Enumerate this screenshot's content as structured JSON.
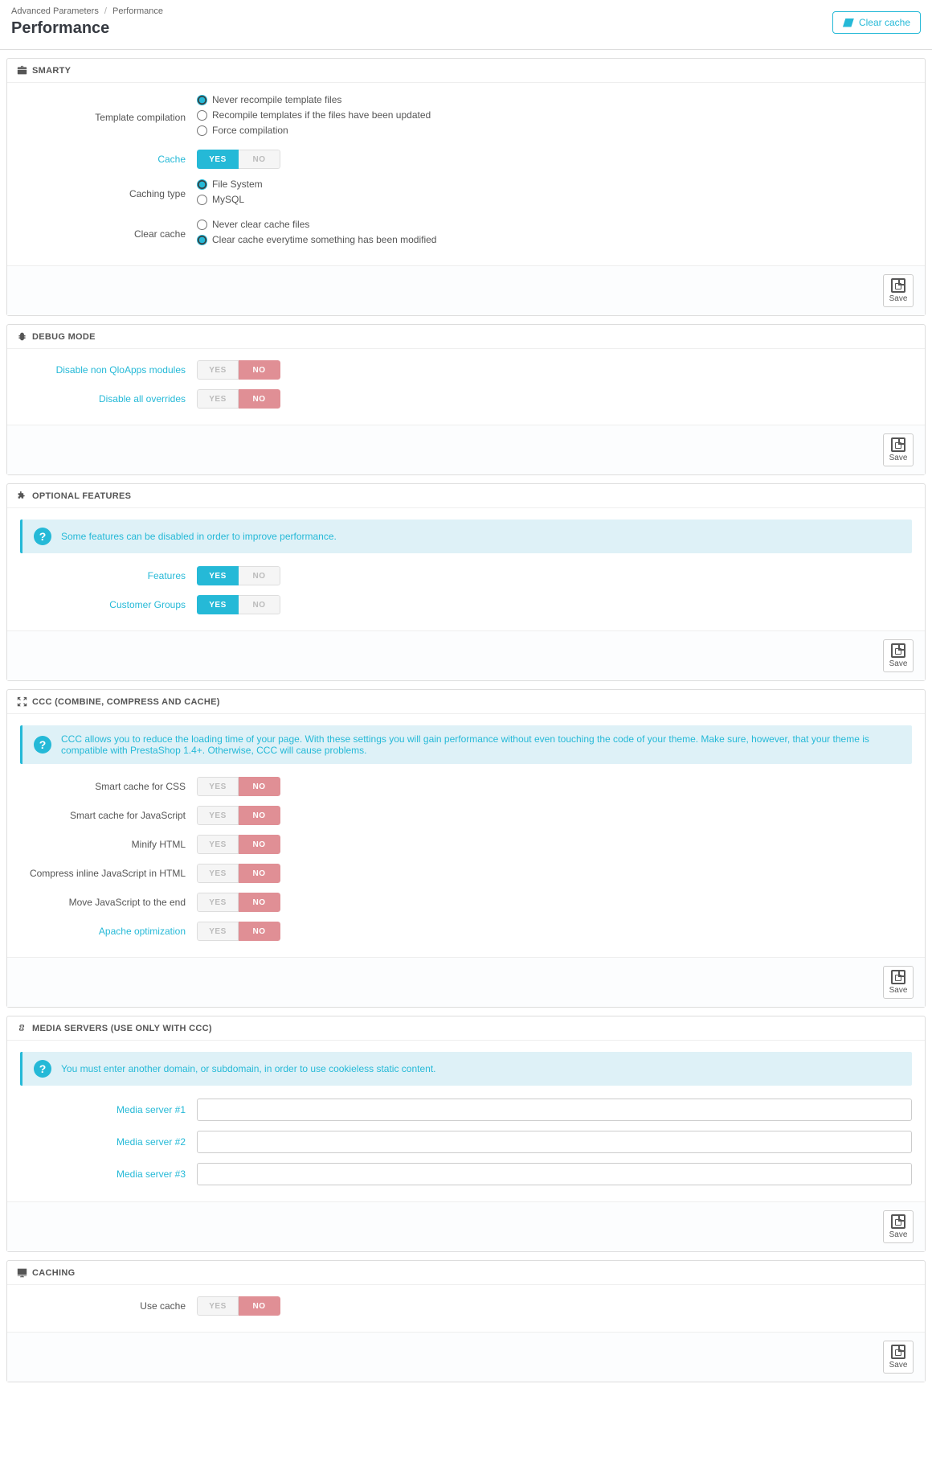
{
  "breadcrumb": {
    "parent": "Advanced Parameters",
    "current": "Performance"
  },
  "pageTitle": "Performance",
  "clearCacheBtn": "Clear cache",
  "saveLabel": "Save",
  "toggleYes": "YES",
  "toggleNo": "NO",
  "smarty": {
    "heading": "SMARTY",
    "templateCompilation": {
      "label": "Template compilation",
      "options": [
        "Never recompile template files",
        "Recompile templates if the files have been updated",
        "Force compilation"
      ],
      "selectedIndex": 0
    },
    "cache": {
      "label": "Cache",
      "value": "yes"
    },
    "cachingType": {
      "label": "Caching type",
      "options": [
        "File System",
        "MySQL"
      ],
      "selectedIndex": 0
    },
    "clearCache": {
      "label": "Clear cache",
      "options": [
        "Never clear cache files",
        "Clear cache everytime something has been modified"
      ],
      "selectedIndex": 1
    }
  },
  "debug": {
    "heading": "DEBUG MODE",
    "disableNonQlo": {
      "label": "Disable non QloApps modules",
      "value": "no"
    },
    "disableOverrides": {
      "label": "Disable all overrides",
      "value": "no"
    }
  },
  "optional": {
    "heading": "OPTIONAL FEATURES",
    "alert": "Some features can be disabled in order to improve performance.",
    "features": {
      "label": "Features",
      "value": "yes"
    },
    "customerGroups": {
      "label": "Customer Groups",
      "value": "yes"
    }
  },
  "ccc": {
    "heading": "CCC (COMBINE, COMPRESS AND CACHE)",
    "alert": "CCC allows you to reduce the loading time of your page. With these settings you will gain performance without even touching the code of your theme. Make sure, however, that your theme is compatible with PrestaShop 1.4+. Otherwise, CCC will cause problems.",
    "smartCss": {
      "label": "Smart cache for CSS",
      "value": "no"
    },
    "smartJs": {
      "label": "Smart cache for JavaScript",
      "value": "no"
    },
    "minifyHtml": {
      "label": "Minify HTML",
      "value": "no"
    },
    "compressJs": {
      "label": "Compress inline JavaScript in HTML",
      "value": "no"
    },
    "moveJs": {
      "label": "Move JavaScript to the end",
      "value": "no"
    },
    "apache": {
      "label": "Apache optimization",
      "value": "no"
    }
  },
  "media": {
    "heading": "MEDIA SERVERS (USE ONLY WITH CCC)",
    "alert": "You must enter another domain, or subdomain, in order to use cookieless static content.",
    "server1": {
      "label": "Media server #1",
      "value": ""
    },
    "server2": {
      "label": "Media server #2",
      "value": ""
    },
    "server3": {
      "label": "Media server #3",
      "value": ""
    }
  },
  "caching": {
    "heading": "CACHING",
    "useCache": {
      "label": "Use cache",
      "value": "no"
    }
  }
}
